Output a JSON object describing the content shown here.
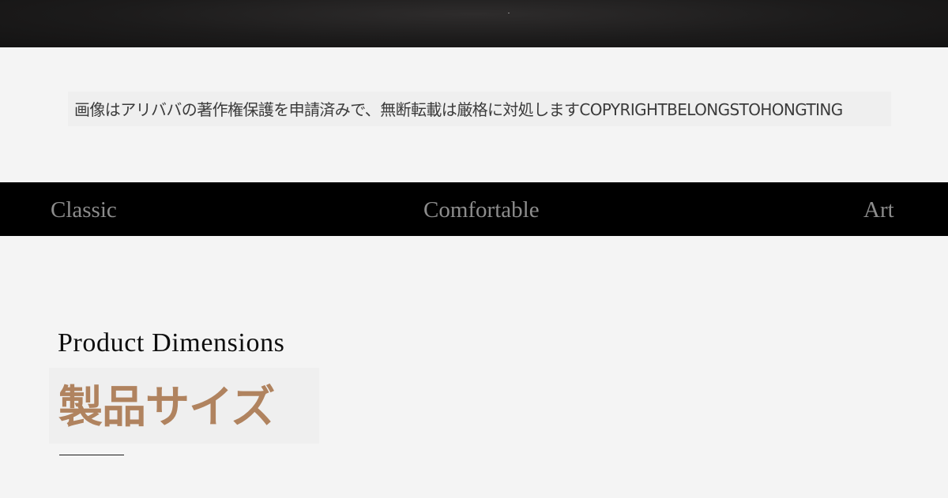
{
  "banner": {
    "copyright_notice": "画像はアリババの著作権保護を申請済みで、無断転載は厳格に対処しますCOPYRIGHTBELONGSTOHONGTING"
  },
  "taglines": [
    "Classic",
    "Comfortable",
    "Art"
  ],
  "section": {
    "title_en": "Product Dimensions",
    "title_jp": "製品サイズ"
  },
  "colors": {
    "background": "#f4f4f4",
    "tagline_bar": "#000000",
    "tagline_text": "#8c8c8c",
    "accent": "#b0835f",
    "top_band": "#1c1b1b"
  }
}
